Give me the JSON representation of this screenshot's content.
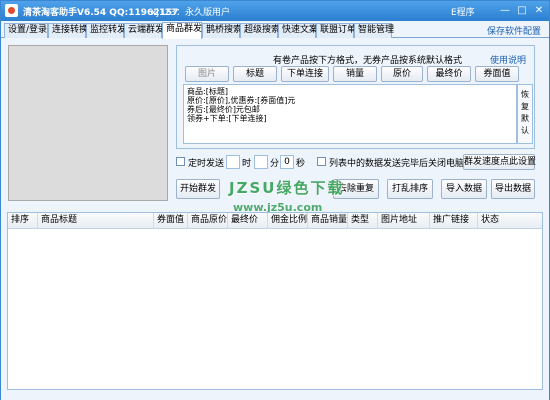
{
  "titlebar": {
    "title": "清茶淘客助手V6.54 QQ:11962157",
    "user": "xj123：永久版用户",
    "program": "E程序",
    "min_label": "—",
    "max_label": "□",
    "close_label": "✕"
  },
  "tabs": [
    {
      "label": "设置/登录"
    },
    {
      "label": "连接转换"
    },
    {
      "label": "监控转发"
    },
    {
      "label": "云端群发"
    },
    {
      "label": "商品群发",
      "active": true
    },
    {
      "label": "鹊桥搜索"
    },
    {
      "label": "超级搜索"
    },
    {
      "label": "快速文案"
    },
    {
      "label": "联盟订单"
    },
    {
      "label": "智能管理"
    }
  ],
  "save_config": "保存软件配置",
  "format_panel": {
    "title": "有卷产品按下方格式，无券产品按系统默认格式",
    "help": "使用说明",
    "buttons": [
      {
        "label": "图片",
        "disabled": true
      },
      {
        "label": "标题"
      },
      {
        "label": "下单连接"
      },
      {
        "label": "销量"
      },
      {
        "label": "原价"
      },
      {
        "label": "最终价"
      },
      {
        "label": "券面值"
      }
    ],
    "template_lines": [
      "商品:[标题]",
      "原价:[原价],优惠券:[券面值]元",
      "券后:[最终价]元包邮",
      "领券+下单:[下单连接]"
    ],
    "restore_label": "恢复默认"
  },
  "schedule": {
    "timed_send_label": "定时发送",
    "hour_value": "",
    "hour_label": "时",
    "minute_value": "",
    "minute_label": "分",
    "second_value": "0",
    "second_label": "秒",
    "close_pc_label": "列表中的数据发送完毕后关闭电脑",
    "speed_button": "群发速度点此设置"
  },
  "actions": {
    "start": "开始群发",
    "dedupe": "去除重复",
    "shuffle": "打乱排序",
    "import": "导入数据",
    "export": "导出数据"
  },
  "watermark": {
    "line1": "JZSU绿色下载",
    "line2": "www.jz5u.com"
  },
  "grid": {
    "columns": [
      "排序",
      "商品标题",
      "券面值",
      "商品原价",
      "最终价",
      "佣金比例",
      "商品销量",
      "类型",
      "图片地址",
      "推广链接",
      "状态"
    ]
  }
}
